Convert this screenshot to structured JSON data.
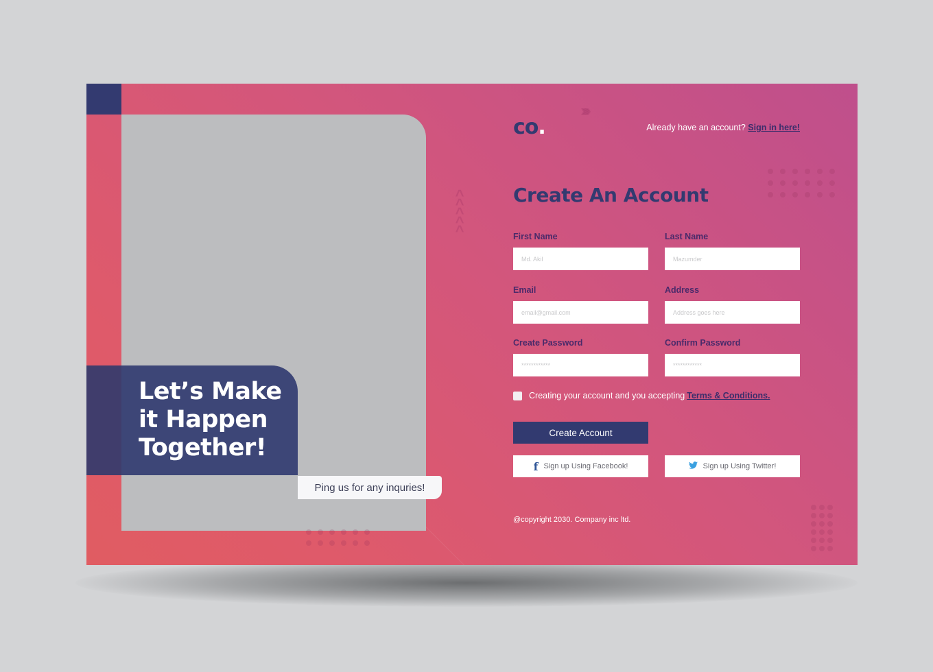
{
  "brand": {
    "logo_text": "co",
    "logo_dot": "."
  },
  "header": {
    "prompt": "Already have an account?",
    "signin_link": "Sign in here!"
  },
  "form": {
    "title": "Create An Account",
    "fields": [
      {
        "label": "First Name",
        "placeholder": "Md. Akil",
        "value": ""
      },
      {
        "label": "Last Name",
        "placeholder": "Mazumder",
        "value": ""
      },
      {
        "label": "Email",
        "placeholder": "email@gmail.com",
        "value": ""
      },
      {
        "label": "Address",
        "placeholder": "Address goes here",
        "value": ""
      },
      {
        "label": "Create Password",
        "placeholder": "************",
        "value": ""
      },
      {
        "label": "Confirm Password",
        "placeholder": "************",
        "value": ""
      }
    ],
    "terms_text": "Creating your account and you accepting",
    "terms_link": "Terms & Conditions.",
    "terms_checked": false,
    "submit_label": "Create Account",
    "facebook_label": "Sign up Using Facebook!",
    "twitter_label": "Sign up Using Twitter!",
    "facebook_icon": "f",
    "twitter_icon": "❧"
  },
  "hero": {
    "tagline_lines": [
      "Let’s Make",
      "it Happen",
      "Together!"
    ],
    "ping_text": "Ping us for any inquries!"
  },
  "footer": {
    "copyright": "@copyright 2030. Company inc ltd."
  },
  "colors": {
    "navy": "#333a70",
    "pink_gradient_start": "#e05c62",
    "pink_gradient_end": "#bf4f8c",
    "photo_placeholder": "#bcbdbf",
    "background": "#d3d4d6"
  }
}
